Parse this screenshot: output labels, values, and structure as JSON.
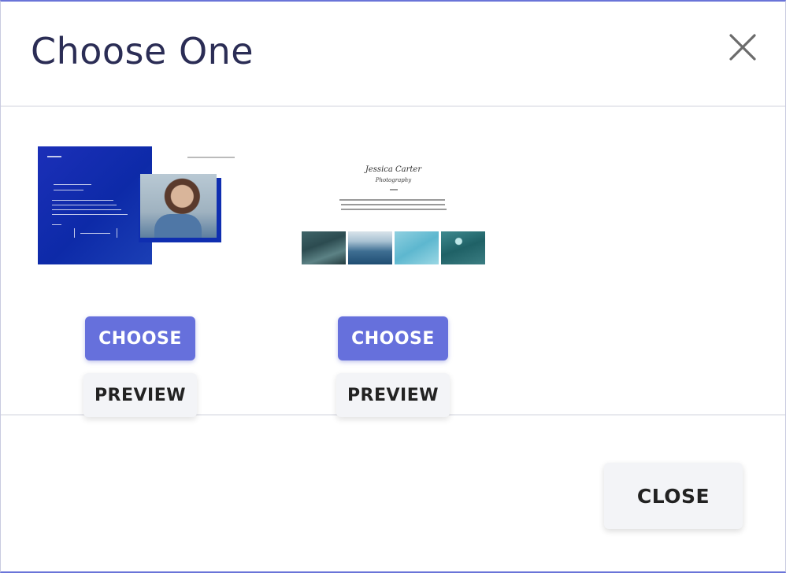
{
  "dialog": {
    "title": "Choose One",
    "footer": {
      "close_label": "CLOSE"
    }
  },
  "templates": [
    {
      "choose_label": "CHOOSE",
      "preview_label": "PREVIEW"
    },
    {
      "name_line": "Jessica Carter",
      "subtitle_line": "Photography",
      "choose_label": "CHOOSE",
      "preview_label": "PREVIEW"
    }
  ],
  "icons": {
    "close": "close-icon"
  },
  "colors": {
    "title_text": "#2b2d55",
    "primary_button": "#6670dc",
    "secondary_button": "#f3f4f7",
    "accent_border": "#6a74d8"
  }
}
